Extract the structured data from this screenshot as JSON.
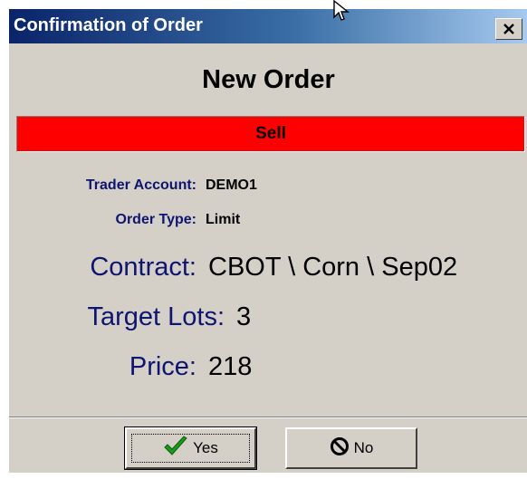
{
  "dialog": {
    "title": "Confirmation of Order",
    "close_icon": "close-icon",
    "heading": "New Order",
    "side": "Sell",
    "side_color": "#ff0000",
    "fields": {
      "trader_account": {
        "label": "Trader Account:",
        "value": "DEMO1"
      },
      "order_type": {
        "label": "Order Type:",
        "value": "Limit"
      },
      "contract": {
        "label": "Contract:",
        "value": "CBOT \\ Corn \\ Sep02"
      },
      "target_lots": {
        "label": "Target Lots:",
        "value": "3"
      },
      "price": {
        "label": "Price:",
        "value": "218"
      }
    },
    "buttons": {
      "yes": {
        "label": "Yes",
        "icon": "checkmark-icon"
      },
      "no": {
        "label": "No",
        "icon": "prohibited-icon"
      }
    },
    "colors": {
      "label_color": "#0d1570",
      "title_gradient_start": "#0a246a",
      "title_gradient_end": "#a6caf0",
      "dialog_background": "#d4d0c8",
      "checkmark_color": "#1a9a1a"
    }
  }
}
